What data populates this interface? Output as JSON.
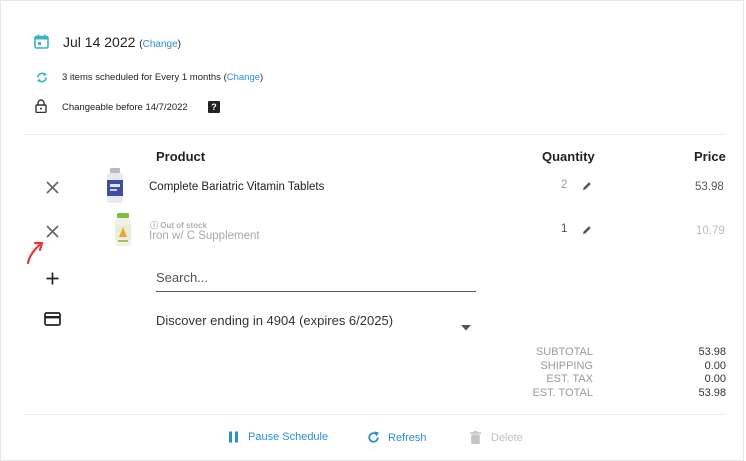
{
  "schedule": {
    "date": "Jul 14 2022",
    "change_link": "Change",
    "items_text": "3 items scheduled for Every 1 months",
    "items_change": "Change",
    "changeable_text": "Changeable before 14/7/2022",
    "paren_open": "(",
    "paren_close": ")",
    "help_glyph": "?"
  },
  "table": {
    "headers": {
      "product": "Product",
      "quantity": "Quantity",
      "price": "Price"
    },
    "rows": [
      {
        "name": "Complete Bariatric Vitamin Tablets",
        "quantity": "2",
        "price": "53.98",
        "status": ""
      },
      {
        "name": "Iron w/ C Supplement",
        "quantity": "1",
        "price": "10.79",
        "status": "Out of stock"
      }
    ]
  },
  "add_item": {
    "placeholder": "Search..."
  },
  "payment": {
    "selected": "Discover ending in 4904 (expires 6/2025)"
  },
  "summary": {
    "labels": [
      "SUBTOTAL",
      "SHIPPING",
      "EST. TAX",
      "EST. TOTAL"
    ],
    "values": [
      "53.98",
      "0.00",
      "0.00",
      "53.98"
    ]
  },
  "actions": {
    "pause": "Pause Schedule",
    "refresh": "Refresh",
    "delete": "Delete"
  },
  "colors": {
    "accent": "#2b8fd6",
    "teal": "#3bb3c3",
    "annotation": "#e53935",
    "muted": "#9a9a9a"
  }
}
